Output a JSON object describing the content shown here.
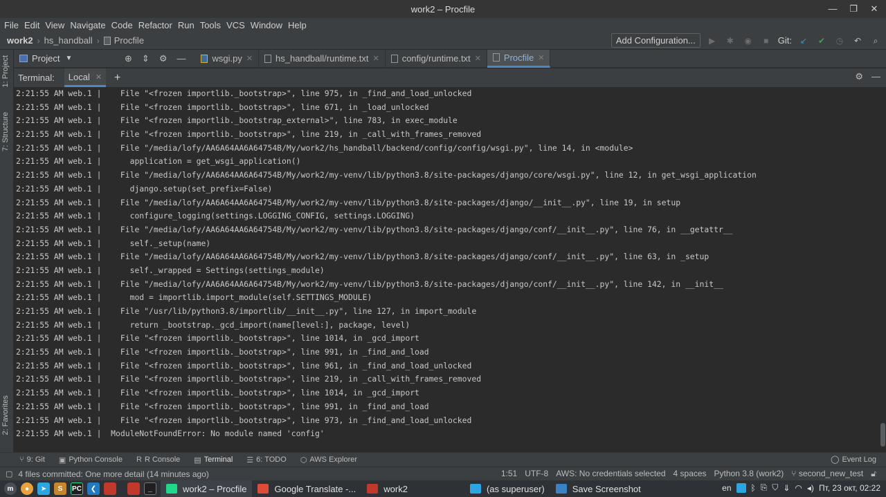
{
  "window": {
    "title": "work2 – Procfile"
  },
  "menu": [
    "File",
    "Edit",
    "View",
    "Navigate",
    "Code",
    "Refactor",
    "Run",
    "Tools",
    "VCS",
    "Window",
    "Help"
  ],
  "breadcrumb": {
    "project": "work2",
    "folder": "hs_handball",
    "file": "Procfile"
  },
  "toolbar": {
    "add_config": "Add Configuration...",
    "git_label": "Git:"
  },
  "left_strip": {
    "project": "1: Project",
    "structure": "7: Structure",
    "favorites": "2: Favorites"
  },
  "project_panel": {
    "label": "Project"
  },
  "tabs": [
    {
      "label": "wsgi.py",
      "icon": "python-file-icon",
      "active": false
    },
    {
      "label": "hs_handball/runtime.txt",
      "icon": "text-file-icon",
      "active": false
    },
    {
      "label": "config/runtime.txt",
      "icon": "text-file-icon",
      "active": false
    },
    {
      "label": "Procfile",
      "icon": "text-file-icon",
      "active": true
    }
  ],
  "terminal": {
    "label": "Terminal:",
    "tab": "Local",
    "lines": [
      "2:21:55 AM web.1 |    File \"<frozen importlib._bootstrap>\", line 975, in _find_and_load_unlocked",
      "2:21:55 AM web.1 |    File \"<frozen importlib._bootstrap>\", line 671, in _load_unlocked",
      "2:21:55 AM web.1 |    File \"<frozen importlib._bootstrap_external>\", line 783, in exec_module",
      "2:21:55 AM web.1 |    File \"<frozen importlib._bootstrap>\", line 219, in _call_with_frames_removed",
      "2:21:55 AM web.1 |    File \"/media/lofy/AA6A64AA6A64754B/My/work2/hs_handball/backend/config/config/wsgi.py\", line 14, in <module>",
      "2:21:55 AM web.1 |      application = get_wsgi_application()",
      "2:21:55 AM web.1 |    File \"/media/lofy/AA6A64AA6A64754B/My/work2/my-venv/lib/python3.8/site-packages/django/core/wsgi.py\", line 12, in get_wsgi_application",
      "2:21:55 AM web.1 |      django.setup(set_prefix=False)",
      "2:21:55 AM web.1 |    File \"/media/lofy/AA6A64AA6A64754B/My/work2/my-venv/lib/python3.8/site-packages/django/__init__.py\", line 19, in setup",
      "2:21:55 AM web.1 |      configure_logging(settings.LOGGING_CONFIG, settings.LOGGING)",
      "2:21:55 AM web.1 |    File \"/media/lofy/AA6A64AA6A64754B/My/work2/my-venv/lib/python3.8/site-packages/django/conf/__init__.py\", line 76, in __getattr__",
      "2:21:55 AM web.1 |      self._setup(name)",
      "2:21:55 AM web.1 |    File \"/media/lofy/AA6A64AA6A64754B/My/work2/my-venv/lib/python3.8/site-packages/django/conf/__init__.py\", line 63, in _setup",
      "2:21:55 AM web.1 |      self._wrapped = Settings(settings_module)",
      "2:21:55 AM web.1 |    File \"/media/lofy/AA6A64AA6A64754B/My/work2/my-venv/lib/python3.8/site-packages/django/conf/__init__.py\", line 142, in __init__",
      "2:21:55 AM web.1 |      mod = importlib.import_module(self.SETTINGS_MODULE)",
      "2:21:55 AM web.1 |    File \"/usr/lib/python3.8/importlib/__init__.py\", line 127, in import_module",
      "2:21:55 AM web.1 |      return _bootstrap._gcd_import(name[level:], package, level)",
      "2:21:55 AM web.1 |    File \"<frozen importlib._bootstrap>\", line 1014, in _gcd_import",
      "2:21:55 AM web.1 |    File \"<frozen importlib._bootstrap>\", line 991, in _find_and_load",
      "2:21:55 AM web.1 |    File \"<frozen importlib._bootstrap>\", line 961, in _find_and_load_unlocked",
      "2:21:55 AM web.1 |    File \"<frozen importlib._bootstrap>\", line 219, in _call_with_frames_removed",
      "2:21:55 AM web.1 |    File \"<frozen importlib._bootstrap>\", line 1014, in _gcd_import",
      "2:21:55 AM web.1 |    File \"<frozen importlib._bootstrap>\", line 991, in _find_and_load",
      "2:21:55 AM web.1 |    File \"<frozen importlib._bootstrap>\", line 973, in _find_and_load_unlocked",
      "2:21:55 AM web.1 |  ModuleNotFoundError: No module named 'config'"
    ]
  },
  "tool_windows": [
    {
      "label": "9: Git",
      "icon": "git-branch-icon",
      "active": false
    },
    {
      "label": "Python Console",
      "icon": "python-console-icon",
      "active": false
    },
    {
      "label": "R Console",
      "icon": "r-console-icon",
      "active": false
    },
    {
      "label": "Terminal",
      "icon": "terminal-icon",
      "active": true
    },
    {
      "label": "6: TODO",
      "icon": "todo-list-icon",
      "active": false
    },
    {
      "label": "AWS Explorer",
      "icon": "aws-cube-icon",
      "active": false
    }
  ],
  "event_log": "Event Log",
  "status": {
    "message": "4 files committed: One more detail (14 minutes ago)",
    "position": "1:51",
    "encoding": "UTF-8",
    "aws": "AWS: No credentials selected",
    "indent": "4 spaces",
    "interpreter": "Python 3.8 (work2)",
    "branch": "second_new_test"
  },
  "taskbar": {
    "items": [
      {
        "label": "work2 – Procfile",
        "active": true,
        "color": "#21d789"
      },
      {
        "label": "Google Translate -...",
        "active": false,
        "color": "#dd4b39"
      },
      {
        "label": "work2",
        "active": false,
        "color": "#c0392b"
      },
      {
        "label": "(as superuser)",
        "active": false,
        "color": "#2ca5e0"
      },
      {
        "label": "Save Screenshot",
        "active": false,
        "color": "#3b82c4"
      }
    ],
    "lang": "en",
    "clock": "Пт, 23 окт, 02:22"
  }
}
